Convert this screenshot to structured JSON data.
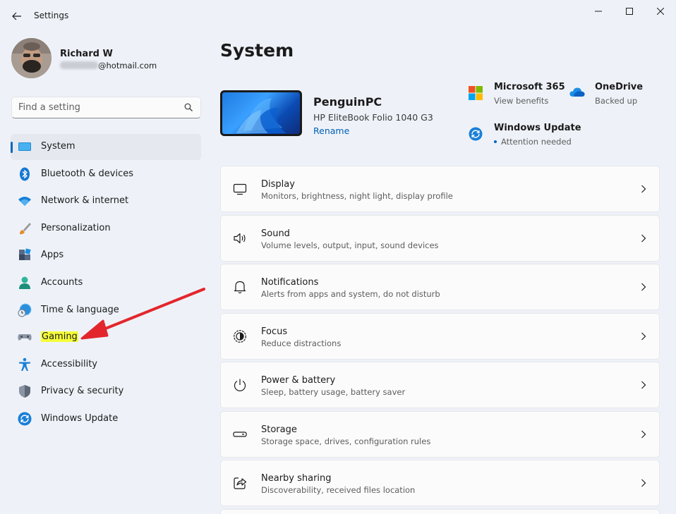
{
  "window": {
    "title": "Settings"
  },
  "profile": {
    "name": "Richard W",
    "email_suffix": "@hotmail.com"
  },
  "search": {
    "placeholder": "Find a setting",
    "icon": "search-icon"
  },
  "nav": {
    "items": [
      {
        "label": "System",
        "icon": "system-icon",
        "active": true
      },
      {
        "label": "Bluetooth & devices",
        "icon": "bluetooth-icon"
      },
      {
        "label": "Network & internet",
        "icon": "wifi-icon"
      },
      {
        "label": "Personalization",
        "icon": "brush-icon"
      },
      {
        "label": "Apps",
        "icon": "apps-icon"
      },
      {
        "label": "Accounts",
        "icon": "accounts-icon"
      },
      {
        "label": "Time & language",
        "icon": "time-language-icon"
      },
      {
        "label": "Gaming",
        "icon": "gaming-icon",
        "highlighted": true
      },
      {
        "label": "Accessibility",
        "icon": "accessibility-icon"
      },
      {
        "label": "Privacy & security",
        "icon": "shield-icon"
      },
      {
        "label": "Windows Update",
        "icon": "windows-update-icon"
      }
    ]
  },
  "main": {
    "title": "System",
    "device": {
      "name": "PenguinPC",
      "model": "HP EliteBook Folio 1040 G3",
      "rename_label": "Rename"
    },
    "quick_links": [
      {
        "title": "Microsoft 365",
        "subtitle": "View benefits",
        "icon": "microsoft-365-icon"
      },
      {
        "title": "OneDrive",
        "subtitle": "Backed up",
        "icon": "onedrive-icon"
      },
      {
        "title": "Windows Update",
        "subtitle": "Attention needed",
        "icon": "windows-update-icon"
      }
    ],
    "cards": [
      {
        "title": "Display",
        "subtitle": "Monitors, brightness, night light, display profile",
        "icon": "display-icon"
      },
      {
        "title": "Sound",
        "subtitle": "Volume levels, output, input, sound devices",
        "icon": "sound-icon"
      },
      {
        "title": "Notifications",
        "subtitle": "Alerts from apps and system, do not disturb",
        "icon": "bell-icon"
      },
      {
        "title": "Focus",
        "subtitle": "Reduce distractions",
        "icon": "focus-icon"
      },
      {
        "title": "Power & battery",
        "subtitle": "Sleep, battery usage, battery saver",
        "icon": "power-icon"
      },
      {
        "title": "Storage",
        "subtitle": "Storage space, drives, configuration rules",
        "icon": "storage-icon"
      },
      {
        "title": "Nearby sharing",
        "subtitle": "Discoverability, received files location",
        "icon": "share-icon"
      }
    ]
  },
  "colors": {
    "accent": "#0067c0",
    "highlight": "#f6ff3a",
    "annotation_arrow": "#e3262d",
    "background": "#eef2f8",
    "card": "#fbfbfc"
  }
}
